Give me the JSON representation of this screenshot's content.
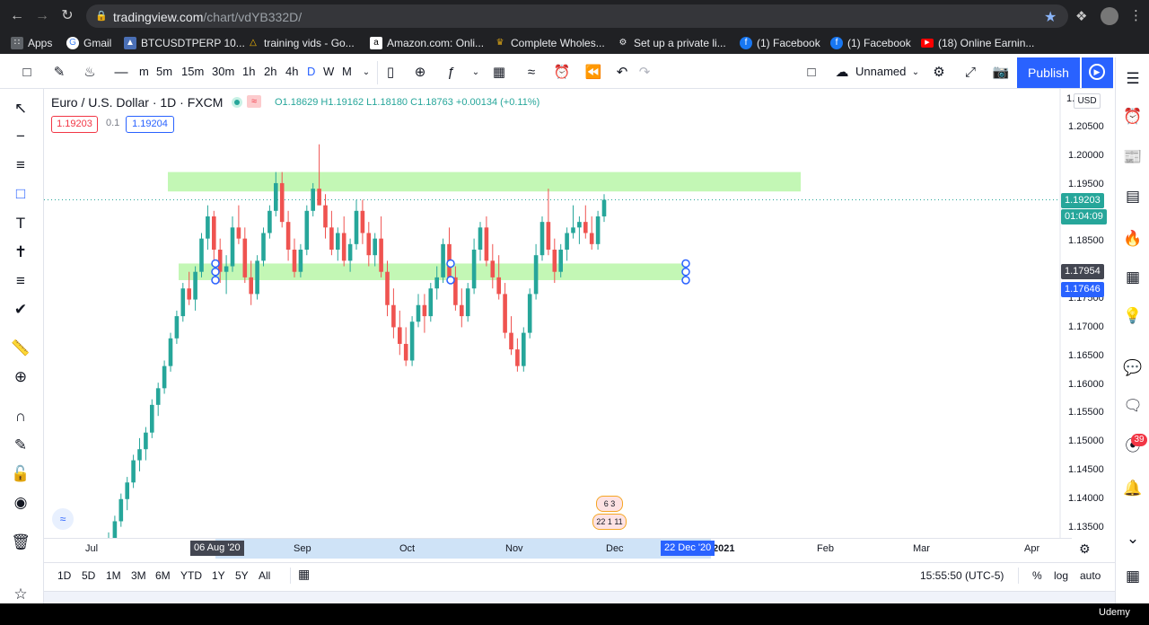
{
  "browser": {
    "url_host": "tradingview.com",
    "url_path": "/chart/vdYB332D/",
    "bookmarks": [
      {
        "label": "Apps",
        "icon": "apps-grid-icon"
      },
      {
        "label": "Gmail",
        "icon": "gmail-icon"
      },
      {
        "label": "BTCUSDTPERP 10...",
        "icon": "chart-icon"
      },
      {
        "label": "training vids - Go...",
        "icon": "drive-icon"
      },
      {
        "label": "Amazon.com: Onli...",
        "icon": "amazon-icon"
      },
      {
        "label": "Complete Wholes...",
        "icon": "crown-icon"
      },
      {
        "label": "Set up a private li...",
        "icon": "robot-icon"
      },
      {
        "label": "(1) Facebook",
        "icon": "facebook-icon"
      },
      {
        "label": "(1) Facebook",
        "icon": "facebook-icon"
      },
      {
        "label": "(18) Online Earnin...",
        "icon": "youtube-icon"
      }
    ]
  },
  "toolbar": {
    "intervals": [
      "m",
      "5m",
      "15m",
      "30m",
      "1h",
      "2h",
      "4h",
      "D",
      "W",
      "M"
    ],
    "layout_name": "Unnamed",
    "publish_label": "Publish"
  },
  "legend": {
    "symbol": "Euro / U.S. Dollar · 1D · FXCM",
    "open": "O1.18629",
    "high": "H1.19162",
    "low": "L1.18180",
    "close": "C1.18763",
    "change": "+0.00134 (+0.11%)",
    "bid": "1.19203",
    "spread": "0.1",
    "ask": "1.19204"
  },
  "price_axis": {
    "currency": "USD",
    "ticks": [
      "1.",
      "1.20500",
      "1.20000",
      "1.19500",
      "1.18500",
      "1.17500",
      "1.17000",
      "1.16500",
      "1.16000",
      "1.15500",
      "1.15000",
      "1.14500",
      "1.14000",
      "1.13500"
    ],
    "last_price": "1.19203",
    "countdown": "01:04:09",
    "level_1": "1.17954",
    "level_2": "1.17646"
  },
  "time_axis": {
    "labels": [
      "Jul",
      "Sep",
      "Oct",
      "Nov",
      "Dec",
      "2021",
      "Feb",
      "Mar",
      "Apr"
    ],
    "range_start": "06 Aug '20",
    "range_end": "22 Dec '20"
  },
  "events": {
    "line1": "6 3",
    "line2": "22 1 11"
  },
  "bottom": {
    "ranges": [
      "1D",
      "5D",
      "1M",
      "3M",
      "6M",
      "YTD",
      "1Y",
      "5Y",
      "All"
    ],
    "clock": "15:55:50 (UTC-5)",
    "percent": "%",
    "log": "log",
    "auto": "auto"
  },
  "right_toolbar": {
    "alerts_count": "39"
  },
  "footer": {
    "brand": "Udemy"
  },
  "colors": {
    "up": "#26a69a",
    "down": "#ef5350",
    "zone": "#b9f6a8",
    "accent": "#2962ff"
  },
  "chart_data": {
    "type": "candlestick",
    "symbol": "EURUSD",
    "timeframe": "1D",
    "ylim": [
      1.13,
      1.211
    ],
    "zones": [
      {
        "from": 1.1925,
        "to": 1.196
      },
      {
        "from": 1.1765,
        "to": 1.1795
      }
    ],
    "candles": [
      [
        1.128,
        1.131,
        1.126,
        1.13
      ],
      [
        1.13,
        1.134,
        1.129,
        1.133
      ],
      [
        1.133,
        1.138,
        1.132,
        1.137
      ],
      [
        1.137,
        1.141,
        1.135,
        1.14
      ],
      [
        1.14,
        1.145,
        1.139,
        1.144
      ],
      [
        1.144,
        1.148,
        1.142,
        1.146
      ],
      [
        1.146,
        1.15,
        1.144,
        1.149
      ],
      [
        1.149,
        1.155,
        1.148,
        1.154
      ],
      [
        1.154,
        1.158,
        1.152,
        1.157
      ],
      [
        1.157,
        1.162,
        1.156,
        1.161
      ],
      [
        1.161,
        1.167,
        1.16,
        1.166
      ],
      [
        1.166,
        1.171,
        1.165,
        1.17
      ],
      [
        1.17,
        1.176,
        1.169,
        1.175
      ],
      [
        1.175,
        1.178,
        1.172,
        1.173
      ],
      [
        1.173,
        1.179,
        1.171,
        1.178
      ],
      [
        1.178,
        1.185,
        1.177,
        1.184
      ],
      [
        1.184,
        1.19,
        1.182,
        1.188
      ],
      [
        1.188,
        1.189,
        1.18,
        1.182
      ],
      [
        1.182,
        1.184,
        1.176,
        1.178
      ],
      [
        1.178,
        1.181,
        1.174,
        1.179
      ],
      [
        1.179,
        1.188,
        1.178,
        1.186
      ],
      [
        1.186,
        1.19,
        1.183,
        1.184
      ],
      [
        1.184,
        1.186,
        1.176,
        1.177
      ],
      [
        1.177,
        1.18,
        1.172,
        1.174
      ],
      [
        1.174,
        1.181,
        1.173,
        1.18
      ],
      [
        1.18,
        1.186,
        1.179,
        1.185
      ],
      [
        1.185,
        1.19,
        1.184,
        1.189
      ],
      [
        1.189,
        1.196,
        1.188,
        1.194
      ],
      [
        1.194,
        1.196,
        1.186,
        1.187
      ],
      [
        1.187,
        1.189,
        1.18,
        1.182
      ],
      [
        1.182,
        1.184,
        1.177,
        1.178
      ],
      [
        1.178,
        1.183,
        1.177,
        1.182
      ],
      [
        1.182,
        1.19,
        1.181,
        1.189
      ],
      [
        1.189,
        1.194,
        1.188,
        1.193
      ],
      [
        1.193,
        1.201,
        1.19,
        1.19
      ],
      [
        1.19,
        1.192,
        1.184,
        1.186
      ],
      [
        1.186,
        1.189,
        1.181,
        1.182
      ],
      [
        1.182,
        1.186,
        1.18,
        1.185
      ],
      [
        1.185,
        1.188,
        1.179,
        1.18
      ],
      [
        1.18,
        1.184,
        1.178,
        1.183
      ],
      [
        1.183,
        1.191,
        1.182,
        1.189
      ],
      [
        1.189,
        1.191,
        1.183,
        1.185
      ],
      [
        1.185,
        1.187,
        1.179,
        1.181
      ],
      [
        1.181,
        1.185,
        1.179,
        1.184
      ],
      [
        1.184,
        1.188,
        1.177,
        1.178
      ],
      [
        1.178,
        1.18,
        1.17,
        1.172
      ],
      [
        1.172,
        1.175,
        1.166,
        1.168
      ],
      [
        1.168,
        1.171,
        1.163,
        1.165
      ],
      [
        1.165,
        1.168,
        1.161,
        1.162
      ],
      [
        1.162,
        1.17,
        1.161,
        1.169
      ],
      [
        1.169,
        1.174,
        1.168,
        1.172
      ],
      [
        1.172,
        1.174,
        1.167,
        1.17
      ],
      [
        1.17,
        1.176,
        1.169,
        1.175
      ],
      [
        1.175,
        1.179,
        1.173,
        1.177
      ],
      [
        1.177,
        1.184,
        1.176,
        1.183
      ],
      [
        1.183,
        1.186,
        1.176,
        1.177
      ],
      [
        1.177,
        1.179,
        1.171,
        1.172
      ],
      [
        1.172,
        1.175,
        1.168,
        1.17
      ],
      [
        1.17,
        1.176,
        1.169,
        1.175
      ],
      [
        1.175,
        1.184,
        1.174,
        1.182
      ],
      [
        1.182,
        1.187,
        1.18,
        1.186
      ],
      [
        1.186,
        1.188,
        1.179,
        1.18
      ],
      [
        1.18,
        1.183,
        1.175,
        1.177
      ],
      [
        1.177,
        1.181,
        1.173,
        1.174
      ],
      [
        1.174,
        1.176,
        1.166,
        1.167
      ],
      [
        1.167,
        1.17,
        1.163,
        1.164
      ],
      [
        1.164,
        1.166,
        1.16,
        1.161
      ],
      [
        1.161,
        1.168,
        1.16,
        1.167
      ],
      [
        1.167,
        1.175,
        1.166,
        1.174
      ],
      [
        1.174,
        1.183,
        1.173,
        1.181
      ],
      [
        1.181,
        1.188,
        1.18,
        1.187
      ],
      [
        1.187,
        1.193,
        1.181,
        1.182
      ],
      [
        1.182,
        1.184,
        1.176,
        1.178
      ],
      [
        1.178,
        1.183,
        1.177,
        1.182
      ],
      [
        1.182,
        1.186,
        1.18,
        1.185
      ],
      [
        1.185,
        1.19,
        1.184,
        1.186
      ],
      [
        1.186,
        1.188,
        1.183,
        1.187
      ],
      [
        1.187,
        1.19,
        1.184,
        1.185
      ],
      [
        1.185,
        1.188,
        1.182,
        1.183
      ],
      [
        1.183,
        1.189,
        1.182,
        1.188
      ],
      [
        1.188,
        1.192,
        1.187,
        1.191
      ]
    ]
  }
}
